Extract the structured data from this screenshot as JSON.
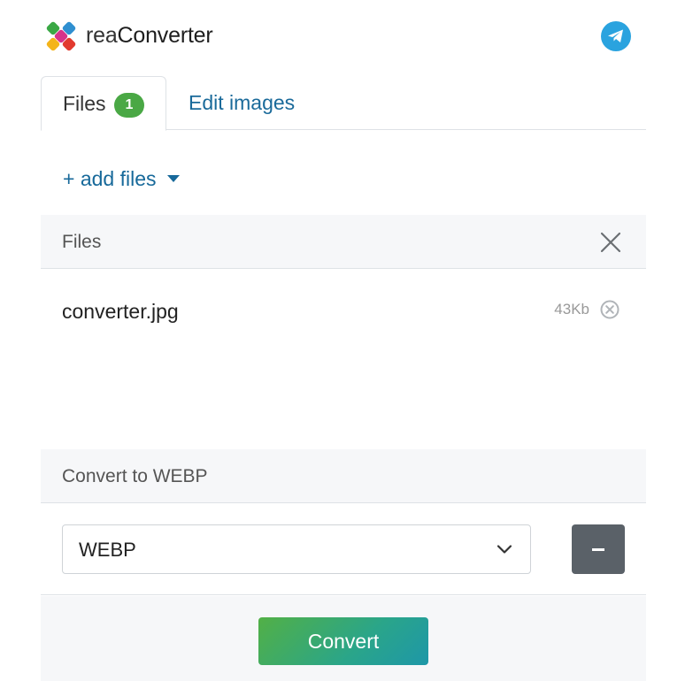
{
  "header": {
    "brand_prefix": "rea",
    "brand_suffix": "Converter",
    "logo_icon": "reaconverter-logo-icon",
    "social_icon": "telegram-icon"
  },
  "tabs": [
    {
      "label": "Files",
      "badge": "1",
      "active": true
    },
    {
      "label": "Edit images",
      "active": false
    }
  ],
  "add_files": {
    "label": "+ add files"
  },
  "files_panel": {
    "title": "Files",
    "items": [
      {
        "name": "converter.jpg",
        "size": "43Kb"
      }
    ]
  },
  "convert_panel": {
    "title": "Convert to WEBP",
    "selected_format": "WEBP",
    "remove_label": "–"
  },
  "footer": {
    "convert_label": "Convert"
  },
  "colors": {
    "accent_link": "#17699a",
    "badge_green": "#4aa845",
    "telegram_blue": "#2aa3df",
    "button_gradient_start": "#52b046",
    "button_gradient_end": "#1e97a8",
    "remove_button": "#5a6168"
  }
}
